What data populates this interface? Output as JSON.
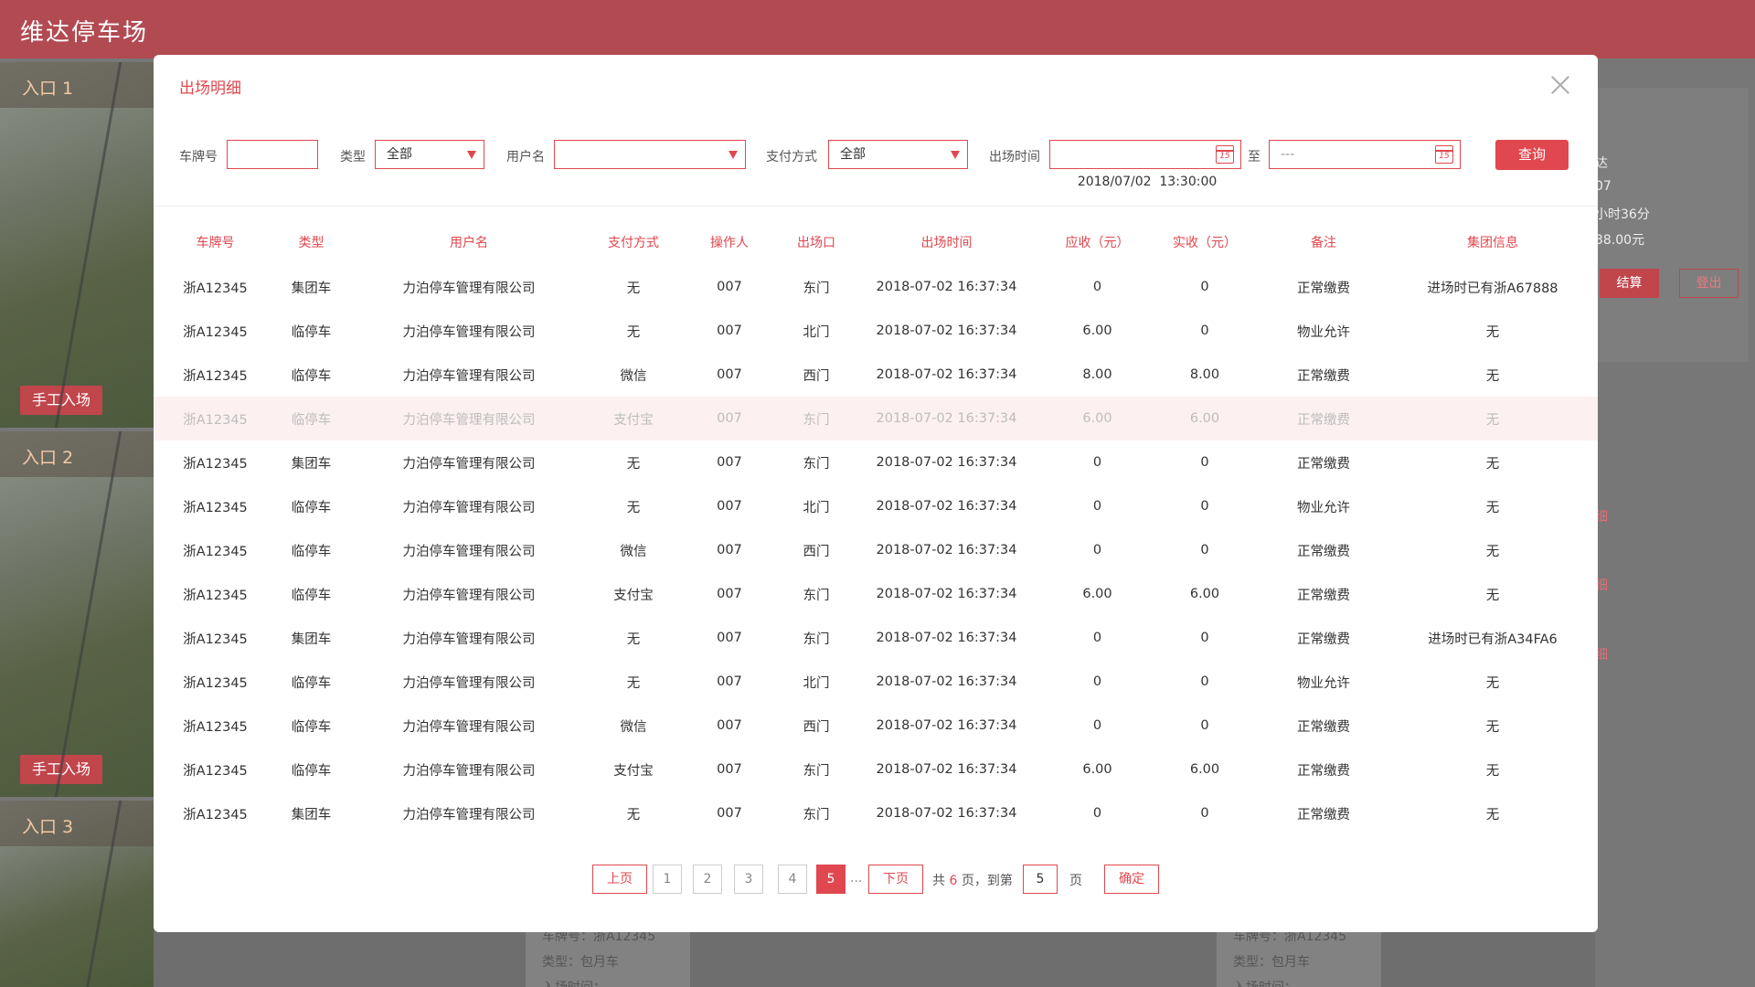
{
  "app": {
    "title": "维达停车场"
  },
  "background": {
    "entrances": [
      {
        "label": "入口 1",
        "button": "手工入场"
      },
      {
        "label": "入口 2",
        "button": "手工入场"
      },
      {
        "label": "入口 3"
      }
    ],
    "right_panel": {
      "lines": [
        "达",
        "07",
        "小时36分",
        "38.00元"
      ],
      "settle_button": "结算",
      "logout_button": "登出",
      "links": [
        "细",
        "细",
        "细"
      ]
    },
    "bottom_cards": [
      {
        "plate": "车牌号：浙A12345",
        "type": "类型：包月车",
        "time": "入场时间："
      },
      {
        "plate": "车牌号：浙A12345",
        "type": "类型：包月车",
        "time": "入场时间："
      }
    ]
  },
  "modal": {
    "title": "出场明细",
    "filters": {
      "plate_label": "车牌号",
      "plate_value": "",
      "type_label": "类型",
      "type_value": "全部",
      "user_label": "用户名",
      "user_value": "",
      "payment_label": "支付方式",
      "payment_value": "全部",
      "time_label": "出场时间",
      "time_from": "2018/07/02  13:30:00",
      "to_label": "至",
      "time_to": "---",
      "calendar_day": "15",
      "query_button": "查询"
    },
    "table": {
      "headers": [
        "车牌号",
        "类型",
        "用户名",
        "支付方式",
        "操作人",
        "出场口",
        "出场时间",
        "应收（元）",
        "实收（元）",
        "备注",
        "集团信息"
      ],
      "rows": [
        [
          "浙A12345",
          "集团车",
          "力泊停车管理有限公司",
          "无",
          "007",
          "东门",
          "2018-07-02  16:37:34",
          "0",
          "0",
          "正常缴费",
          "进场时已有浙A67888"
        ],
        [
          "浙A12345",
          "临停车",
          "力泊停车管理有限公司",
          "无",
          "007",
          "北门",
          "2018-07-02  16:37:34",
          "6.00",
          "0",
          "物业允许",
          "无"
        ],
        [
          "浙A12345",
          "临停车",
          "力泊停车管理有限公司",
          "微信",
          "007",
          "西门",
          "2018-07-02  16:37:34",
          "8.00",
          "8.00",
          "正常缴费",
          "无"
        ],
        [
          "浙A12345",
          "临停车",
          "力泊停车管理有限公司",
          "支付宝",
          "007",
          "东门",
          "2018-07-02  16:37:34",
          "6.00",
          "6.00",
          "正常缴费",
          "无"
        ],
        [
          "浙A12345",
          "集团车",
          "力泊停车管理有限公司",
          "无",
          "007",
          "东门",
          "2018-07-02  16:37:34",
          "0",
          "0",
          "正常缴费",
          "无"
        ],
        [
          "浙A12345",
          "临停车",
          "力泊停车管理有限公司",
          "无",
          "007",
          "北门",
          "2018-07-02  16:37:34",
          "0",
          "0",
          "物业允许",
          "无"
        ],
        [
          "浙A12345",
          "临停车",
          "力泊停车管理有限公司",
          "微信",
          "007",
          "西门",
          "2018-07-02  16:37:34",
          "0",
          "0",
          "正常缴费",
          "无"
        ],
        [
          "浙A12345",
          "临停车",
          "力泊停车管理有限公司",
          "支付宝",
          "007",
          "东门",
          "2018-07-02  16:37:34",
          "6.00",
          "6.00",
          "正常缴费",
          "无"
        ],
        [
          "浙A12345",
          "集团车",
          "力泊停车管理有限公司",
          "无",
          "007",
          "东门",
          "2018-07-02  16:37:34",
          "0",
          "0",
          "正常缴费",
          "进场时已有浙A34FA6"
        ],
        [
          "浙A12345",
          "临停车",
          "力泊停车管理有限公司",
          "无",
          "007",
          "北门",
          "2018-07-02  16:37:34",
          "0",
          "0",
          "物业允许",
          "无"
        ],
        [
          "浙A12345",
          "临停车",
          "力泊停车管理有限公司",
          "微信",
          "007",
          "西门",
          "2018-07-02  16:37:34",
          "0",
          "0",
          "正常缴费",
          "无"
        ],
        [
          "浙A12345",
          "临停车",
          "力泊停车管理有限公司",
          "支付宝",
          "007",
          "东门",
          "2018-07-02  16:37:34",
          "6.00",
          "6.00",
          "正常缴费",
          "无"
        ],
        [
          "浙A12345",
          "集团车",
          "力泊停车管理有限公司",
          "无",
          "007",
          "东门",
          "2018-07-02  16:37:34",
          "0",
          "0",
          "正常缴费",
          "无"
        ]
      ],
      "highlighted_row": 3
    },
    "pagination": {
      "prev_label": "上页",
      "pages": [
        "1",
        "2",
        "3",
        "4",
        "5"
      ],
      "current_page": "5",
      "ellipsis": "...",
      "next_label": "下页",
      "total_prefix": "共",
      "total_pages": "6",
      "total_suffix": "页，到第",
      "jump_value": "5",
      "page_suffix": "页",
      "confirm_label": "确定"
    }
  },
  "colors": {
    "accent": "#e0474e",
    "header": "#b24a52",
    "highlight_row": "#fdf0f0"
  }
}
